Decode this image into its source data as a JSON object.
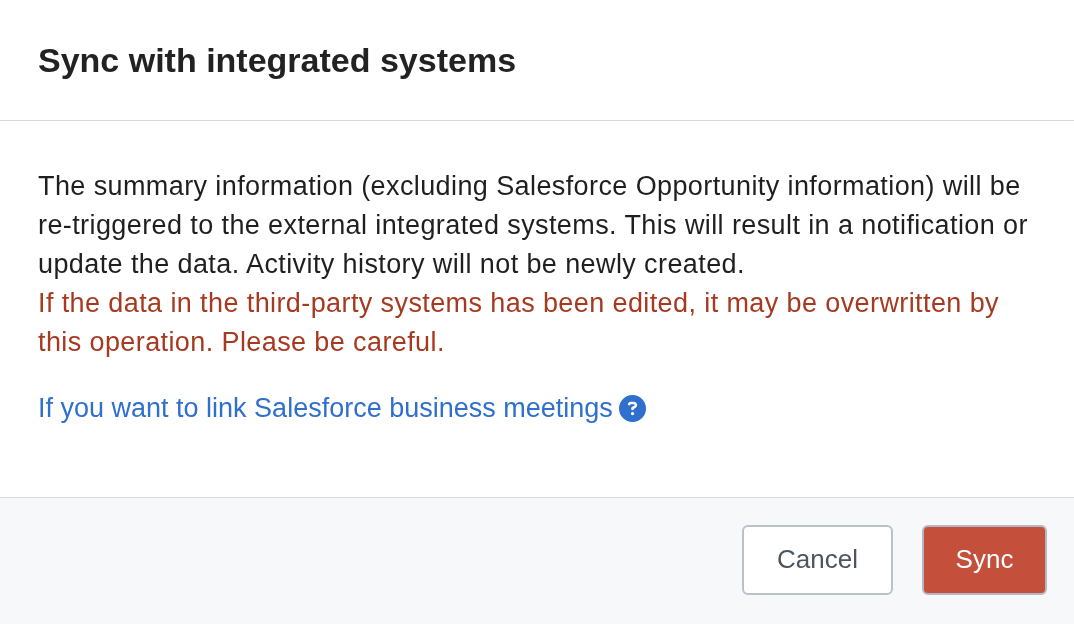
{
  "dialog": {
    "title": "Sync with integrated systems",
    "description": "The summary information (excluding Salesforce Opportunity information) will be re-triggered to the external integrated systems. This will result in a notification or update the data. Activity history will not be newly created.",
    "warning": "If the data in the third-party systems has been edited, it may be overwritten by this operation. Please be careful.",
    "help_link": "If you want to link Salesforce business meetings",
    "buttons": [
      {
        "label": "Cancel",
        "kind": "secondary"
      },
      {
        "label": "Sync",
        "kind": "primary"
      }
    ]
  }
}
